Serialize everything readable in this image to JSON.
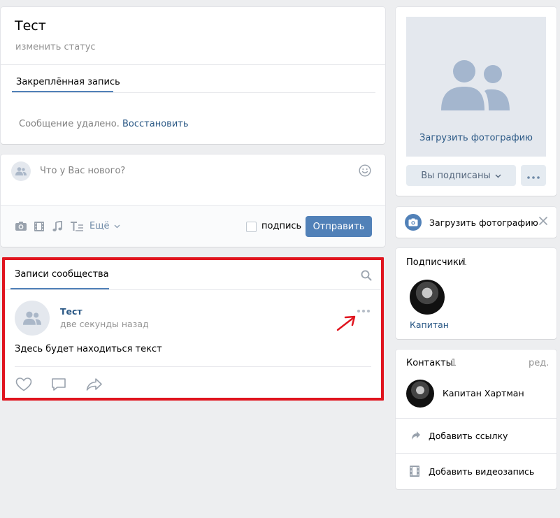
{
  "profile": {
    "name": "Тест",
    "status_link": "изменить статус",
    "pinned_tab": "Закреплённая запись",
    "deleted_message": "Сообщение удалено.",
    "restore_link": "Восстановить"
  },
  "composer": {
    "placeholder": "Что у Вас нового?",
    "more_label": "Ещё",
    "signature_label": "подпись",
    "send_label": "Отправить"
  },
  "posts": {
    "tab": "Записи сообщества",
    "author": "Тест",
    "time": "две секунды назад",
    "text": "Здесь будет находиться текст"
  },
  "sidebar": {
    "upload_photo": "Загрузить фотографию",
    "subscribed_label": "Вы подписаны",
    "upload_banner_label": "Загрузить фотографию",
    "subscribers": {
      "title": "Подписчики",
      "count": "1",
      "items": [
        {
          "name": "Капитан"
        }
      ]
    },
    "contacts": {
      "title": "Контакты",
      "count": "1",
      "edit_label": "ред.",
      "items": [
        {
          "name": "Капитан Хартман"
        }
      ],
      "add_link_label": "Добавить ссылку",
      "add_video_label": "Добавить видеозапись"
    }
  },
  "colors": {
    "accent": "#5181b8",
    "link": "#2a5885",
    "highlight": "#e0141e",
    "icon": "#99a2ad"
  }
}
